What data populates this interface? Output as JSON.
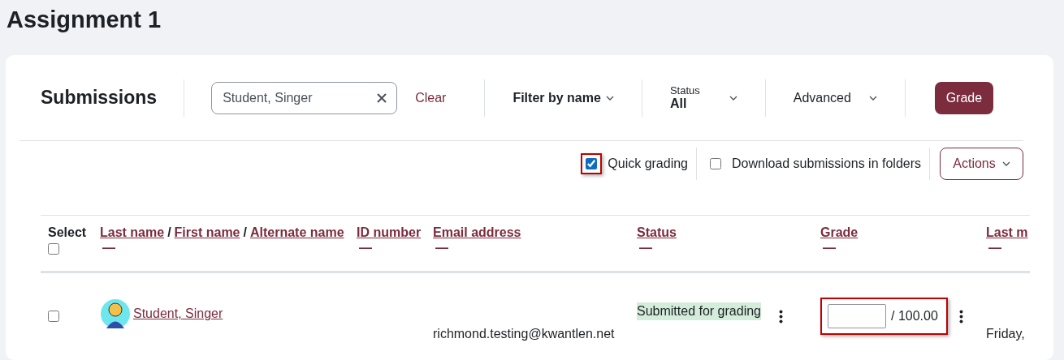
{
  "page_title": "Assignment 1",
  "toolbar": {
    "title": "Submissions",
    "search": {
      "value": "Student, Singer"
    },
    "clear_label": "Clear",
    "filter_by_name": "Filter by name",
    "status": {
      "label": "Status",
      "value": "All"
    },
    "advanced": "Advanced",
    "grade_button": "Grade"
  },
  "options": [
    {
      "kind": "checkbox",
      "label": "Quick grading",
      "checked": true,
      "highlighted": true
    },
    {
      "kind": "checkbox",
      "label": "Download submissions in folders",
      "checked": false,
      "highlighted": false
    }
  ],
  "actions_button": "Actions",
  "table": {
    "select_label": "Select",
    "select_all_checked": false,
    "columns": [
      {
        "links": [
          "Last name",
          "First name",
          "Alternate name"
        ],
        "separator": "/",
        "sort_mark": "—"
      },
      {
        "links": [
          "ID number"
        ],
        "sort_mark": "—"
      },
      {
        "links": [
          "Email address"
        ],
        "sort_mark": "—"
      },
      {
        "links": [
          "Status"
        ],
        "sort_mark": "—"
      },
      {
        "links": [
          "Grade"
        ],
        "sort_mark": "—"
      },
      {
        "links": [
          "Last m"
        ],
        "sort_mark": "—"
      }
    ],
    "rows": [
      {
        "selected": false,
        "name": "Student, Singer",
        "id_number": "",
        "email": "richmond.testing@kwantlen.net",
        "status": "Submitted for grading",
        "grade_value": "",
        "grade_max": "/ 100.00",
        "grade_highlighted": true,
        "last_modified": "Friday,"
      }
    ]
  }
}
